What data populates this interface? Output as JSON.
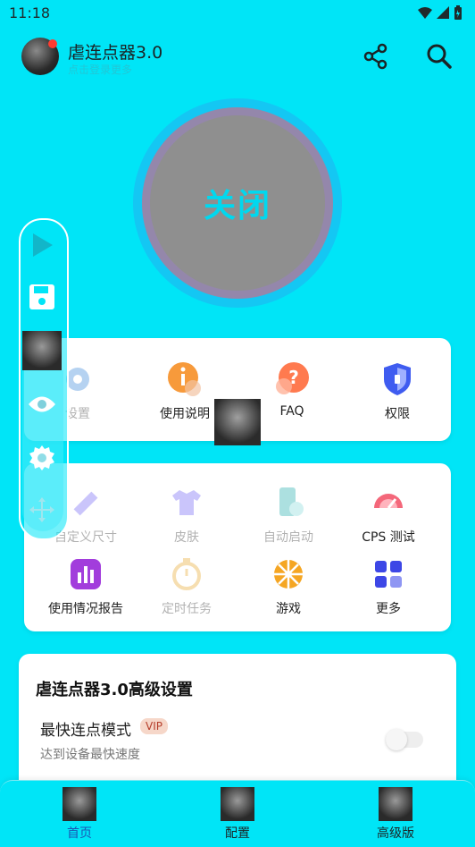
{
  "status_bar": {
    "time": "11:18"
  },
  "header": {
    "title": "虐连点器3.0",
    "subtitle": "点击登录更多"
  },
  "toggle": {
    "label": "关闭"
  },
  "quick_actions": [
    {
      "label": "设置",
      "icon": "settings-icon"
    },
    {
      "label": "使用说明",
      "icon": "info-icon"
    },
    {
      "label": "FAQ",
      "icon": "faq-icon"
    },
    {
      "label": "权限",
      "icon": "permission-shield-icon"
    }
  ],
  "tools": [
    {
      "label": "自定义尺寸",
      "icon": "ruler-pencil-icon"
    },
    {
      "label": "皮肤",
      "icon": "shirt-icon"
    },
    {
      "label": "自动启动",
      "icon": "phone-auto-icon"
    },
    {
      "label": "CPS 测试",
      "icon": "speedometer-icon"
    },
    {
      "label": "使用情况报告",
      "icon": "bar-chart-icon"
    },
    {
      "label": "定时任务",
      "icon": "timer-icon"
    },
    {
      "label": "游戏",
      "icon": "game-wheel-icon"
    },
    {
      "label": "更多",
      "icon": "grid-more-icon"
    }
  ],
  "advanced": {
    "title": "虐连点器3.0高级设置",
    "fast_mode_label": "最快连点模式",
    "vip_badge": "VIP",
    "fast_mode_desc": "达到设备最快速度"
  },
  "bottom_nav": [
    {
      "label": "首页",
      "active": true
    },
    {
      "label": "配置",
      "active": false
    },
    {
      "label": "高级版",
      "active": false
    }
  ],
  "colors": {
    "background": "#00e5f7",
    "accent": "#00d8ef",
    "toggle_fill": "#8f8f8f",
    "active_nav": "#1a57b5"
  }
}
